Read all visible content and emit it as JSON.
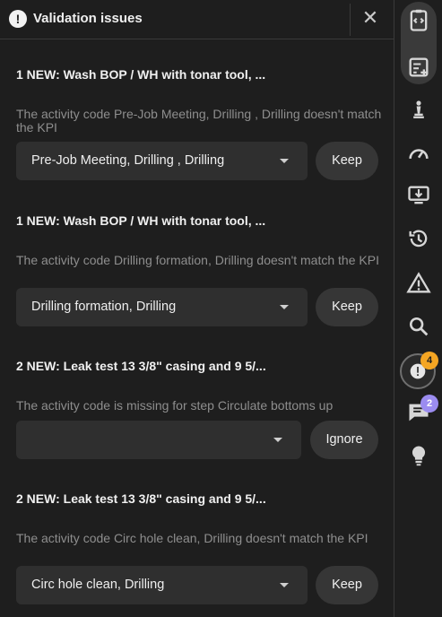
{
  "header": {
    "title": "Validation issues",
    "close_label": "✕"
  },
  "issues": [
    {
      "heading": "1 NEW: Wash BOP / WH with tonar tool, ...",
      "message": "The activity code Pre-Job Meeting, Drilling , Drilling doesn't match the KPI",
      "select_value": "Pre-Job Meeting, Drilling , Drilling",
      "action": "Keep"
    },
    {
      "heading": "1 NEW: Wash BOP / WH with tonar tool, ...",
      "message": "The activity code Drilling formation, Drilling doesn't match the KPI",
      "select_value": "Drilling formation, Drilling",
      "action": "Keep"
    },
    {
      "heading": "2 NEW: Leak test 13 3/8\" casing and 9 5/...",
      "message": "The activity code is missing for step Circulate bottoms up",
      "select_value": "",
      "action": "Ignore"
    },
    {
      "heading": "2 NEW: Leak test 13 3/8\" casing and 9 5/...",
      "message": "The activity code Circ hole clean, Drilling doesn't match the KPI",
      "select_value": "Circ hole clean, Drilling",
      "action": "Keep"
    }
  ],
  "rail": {
    "validation_badge": "4",
    "comments_badge": "2",
    "colors": {
      "validation_badge": "#f5a623",
      "comments_badge": "#9b8cf0"
    }
  }
}
